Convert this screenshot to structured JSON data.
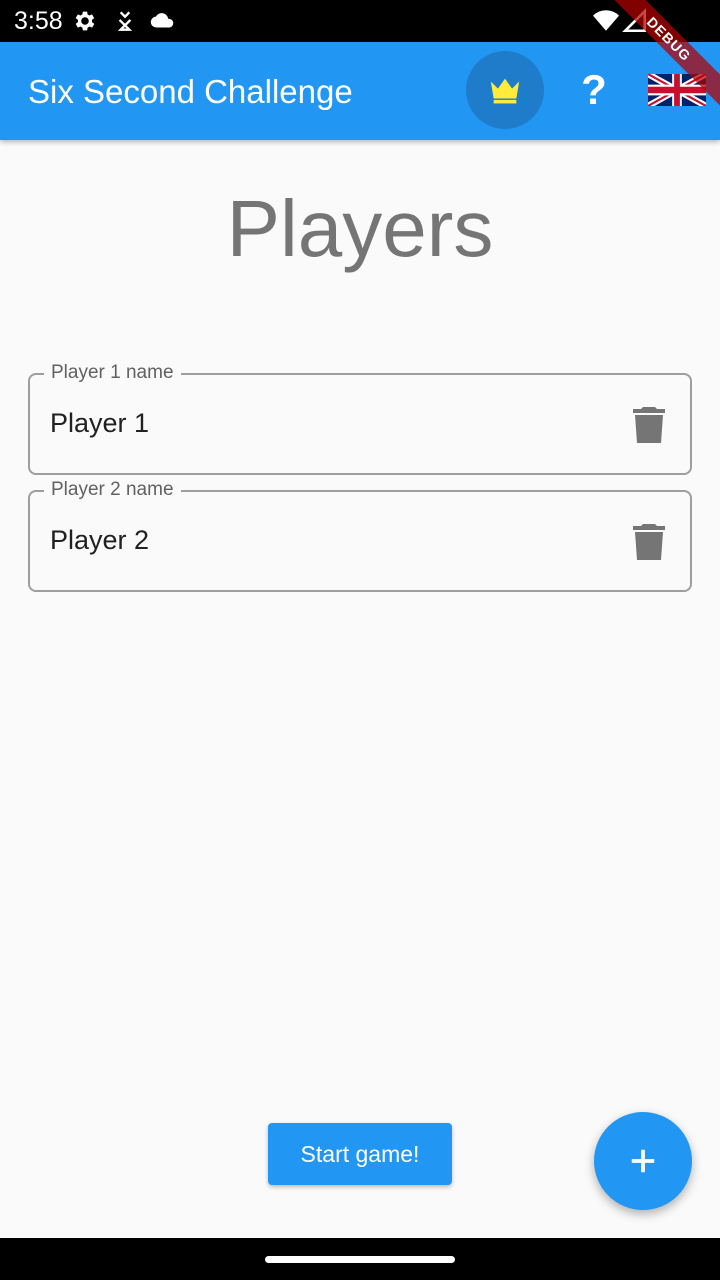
{
  "status_bar": {
    "time": "3:58",
    "left_icons": [
      "settings-icon",
      "download-badge-icon",
      "cloud-icon"
    ],
    "right_icons": [
      "wifi-icon",
      "cell-signal-icon"
    ]
  },
  "debug_banner": {
    "label": "DEBUG"
  },
  "app_bar": {
    "title": "Six Second Challenge",
    "crown_icon": "crown-icon",
    "help_label": "?",
    "language_icon": "uk-flag-icon",
    "colors": {
      "bar": "#2196f3",
      "crown": "#ffeb3b"
    }
  },
  "page": {
    "heading": "Players"
  },
  "players": [
    {
      "label": "Player 1 name",
      "value": "Player 1"
    },
    {
      "label": "Player 2 name",
      "value": "Player 2"
    }
  ],
  "actions": {
    "start_label": "Start game!",
    "add_icon": "plus-icon"
  }
}
